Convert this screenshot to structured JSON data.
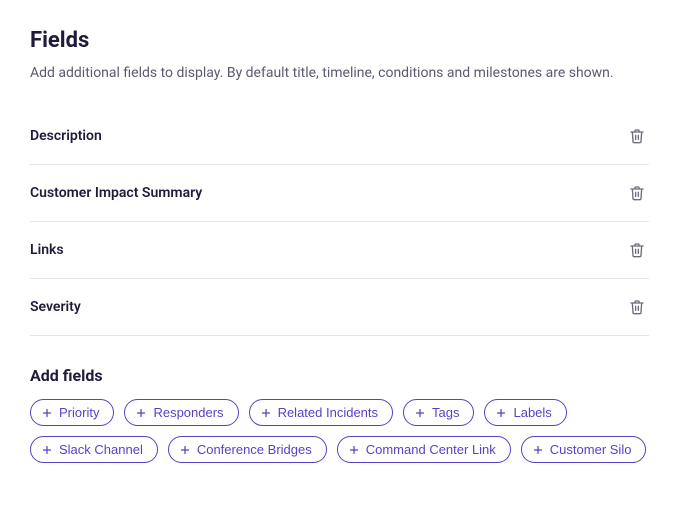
{
  "title": "Fields",
  "subtitle": "Add additional fields to display. By default title, timeline, conditions and milestones are shown.",
  "fields": [
    {
      "label": "Description"
    },
    {
      "label": "Customer Impact Summary"
    },
    {
      "label": "Links"
    },
    {
      "label": "Severity"
    }
  ],
  "addSection": {
    "title": "Add fields",
    "options": [
      {
        "label": "Priority"
      },
      {
        "label": "Responders"
      },
      {
        "label": "Related Incidents"
      },
      {
        "label": "Tags"
      },
      {
        "label": "Labels"
      },
      {
        "label": "Slack Channel"
      },
      {
        "label": "Conference Bridges"
      },
      {
        "label": "Command Center Link"
      },
      {
        "label": "Customer Silo"
      }
    ]
  }
}
